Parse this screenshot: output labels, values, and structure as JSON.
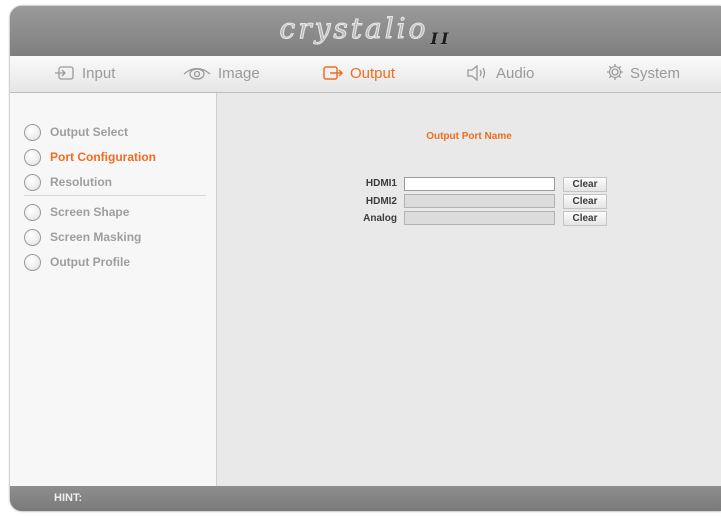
{
  "app": {
    "logo_text": "crystalio",
    "logo_suffix": "II"
  },
  "tabs": [
    {
      "label": "Input",
      "icon": "input-icon",
      "active": false
    },
    {
      "label": "Image",
      "icon": "eye-icon",
      "active": false
    },
    {
      "label": "Output",
      "icon": "output-icon",
      "active": true
    },
    {
      "label": "Audio",
      "icon": "speaker-icon",
      "active": false
    },
    {
      "label": "System",
      "icon": "gear-icon",
      "active": false
    }
  ],
  "sidebar": {
    "items": [
      {
        "label": "Output Select",
        "active": false
      },
      {
        "label": "Port Configuration",
        "active": true
      },
      {
        "label": "Resolution",
        "active": false
      },
      {
        "label": "Screen Shape",
        "active": false
      },
      {
        "label": "Screen Masking",
        "active": false
      },
      {
        "label": "Output Profile",
        "active": false
      }
    ]
  },
  "main": {
    "section_title": "Output Port Name",
    "ports": [
      {
        "label": "HDMI1",
        "value": "",
        "clear_label": "Clear"
      },
      {
        "label": "HDMI2",
        "value": "",
        "clear_label": "Clear"
      },
      {
        "label": "Analog",
        "value": "",
        "clear_label": "Clear"
      }
    ]
  },
  "hint": {
    "label": "HINT:"
  },
  "colors": {
    "accent": "#ee6e1f",
    "chrome": "#8c8c8c",
    "sidebar_bg": "#f7f7f7",
    "main_bg": "#e9e9e9"
  }
}
